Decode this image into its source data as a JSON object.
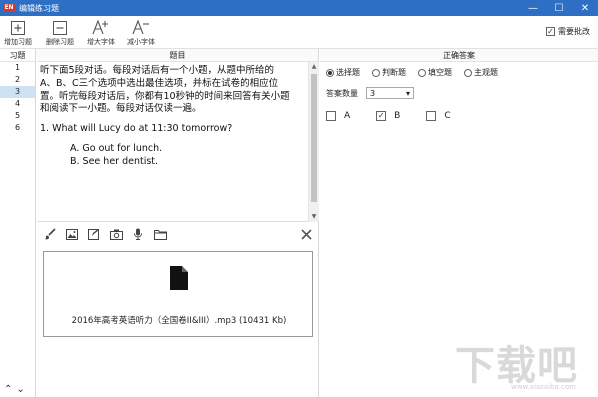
{
  "window": {
    "logo_text": "EN",
    "title": "编辑练习题",
    "controls": [
      "—",
      "☐",
      "✕"
    ]
  },
  "toolbar": {
    "add_label": "增加习题",
    "delete_label": "删除习题",
    "bigger_font_label": "增大字体",
    "smaller_font_label": "减小字体",
    "needs_grading_label": "需要批改",
    "needs_grading_checked": true
  },
  "question_list": {
    "header": "习题",
    "items": [
      "1",
      "2",
      "3",
      "4",
      "5",
      "6"
    ],
    "active_index": 2,
    "nav_up": "⌃",
    "nav_down": "⌄"
  },
  "question_pane": {
    "header": "题目",
    "intro_line1": "听下面5段对话。每段对话后有一个小题，从题中所给的",
    "intro_line2": "A、B、C三个选项中选出最佳选项，并标在试卷的相应位",
    "intro_line3": "置。听完每段对话后，你都有10秒钟的时间来回答有关小题",
    "intro_line4": "和阅读下一小题。每段对话仅读一遍。",
    "question": "1. What will Lucy do at 11:30 tomorrow?",
    "option_a": "A. Go out for lunch.",
    "option_b": "B. See her dentist."
  },
  "attachment": {
    "file_name": "2016年高考英语听力（全国卷II&III）.mp3 (10431 Kb)"
  },
  "answer_pane": {
    "header": "正确答案",
    "types": [
      "选择题",
      "判断题",
      "填空题",
      "主观题"
    ],
    "selected_type_index": 0,
    "count_label": "答案数量",
    "count_value": "3",
    "answers": [
      {
        "label": "A",
        "checked": false
      },
      {
        "label": "B",
        "checked": true
      },
      {
        "label": "C",
        "checked": false
      }
    ]
  },
  "watermark": {
    "text": "下载吧",
    "sub": "www.xiazaiba.com"
  }
}
